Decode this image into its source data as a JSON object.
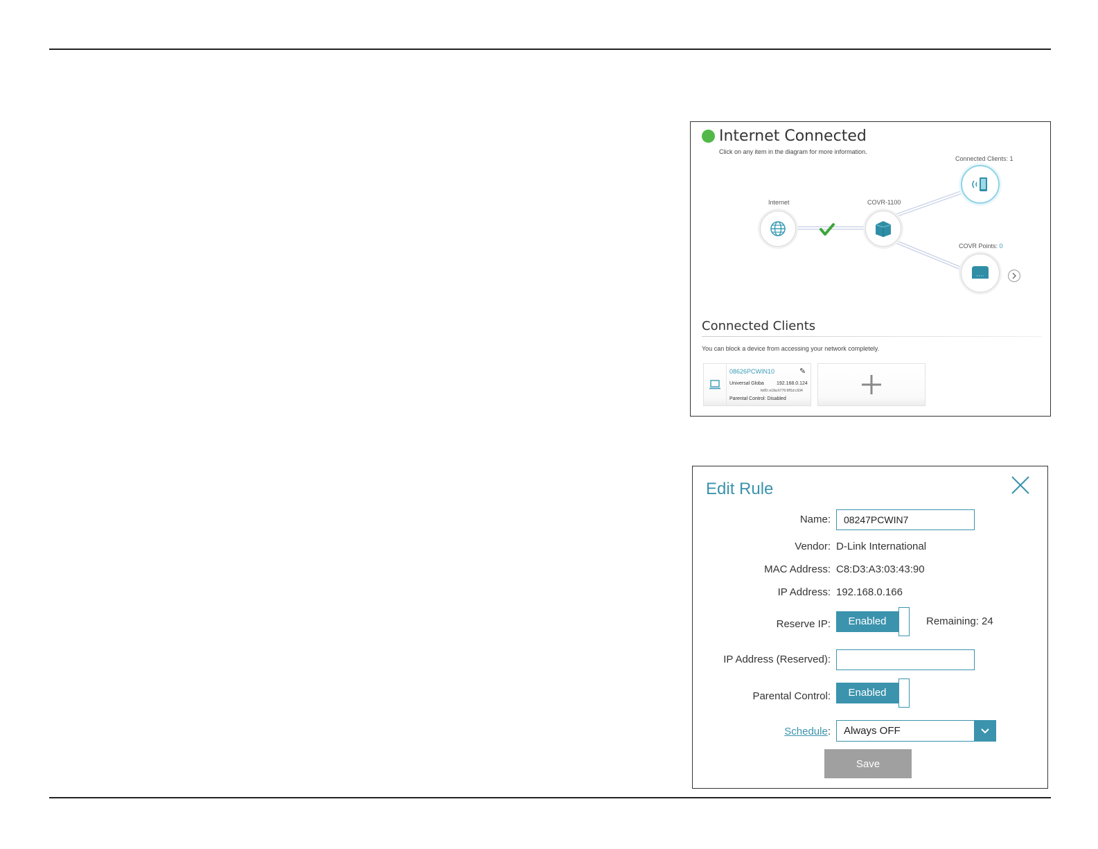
{
  "network_map": {
    "status": "Internet Connected",
    "hint": "Click on any item in the diagram for more information.",
    "nodes": {
      "internet": "Internet",
      "router": "COVR-1100",
      "clients_label": "Connected Clients: ",
      "clients_count": "1",
      "points_label": "COVR Points: ",
      "points_count": "0"
    },
    "section_title": "Connected Clients",
    "section_desc": "You can block a device from accessing your network completely.",
    "client": {
      "name": "08626PCWIN10",
      "vendor": "Universal Globa",
      "ip": "192.168.0.124",
      "ipv6": "fe80::e18a:6776:9ff1d:c934",
      "parental": "Parental Control: Disabled"
    },
    "colors": {
      "status_green": "#52b848",
      "accent": "#3b9bb5"
    }
  },
  "edit_rule": {
    "title": "Edit Rule",
    "fields": {
      "name_label": "Name:",
      "name_value": "08247PCWIN7",
      "vendor_label": "Vendor:",
      "vendor_value": "D-Link International",
      "mac_label": "MAC Address:",
      "mac_value": "C8:D3:A3:03:43:90",
      "ip_label": "IP Address:",
      "ip_value": "192.168.0.166",
      "reserve_label": "Reserve IP:",
      "reserve_state": "Enabled",
      "remaining": "Remaining: 24",
      "ip_reserved_label": "IP Address (Reserved):",
      "ip_reserved_value": "",
      "parental_label": "Parental Control:",
      "parental_state": "Enabled",
      "schedule_link": "Schedule",
      "schedule_colon": ":",
      "schedule_value": "Always OFF"
    },
    "save_label": "Save",
    "colors": {
      "accent": "#3b93ad",
      "save_bg": "#a0a0a0"
    }
  }
}
